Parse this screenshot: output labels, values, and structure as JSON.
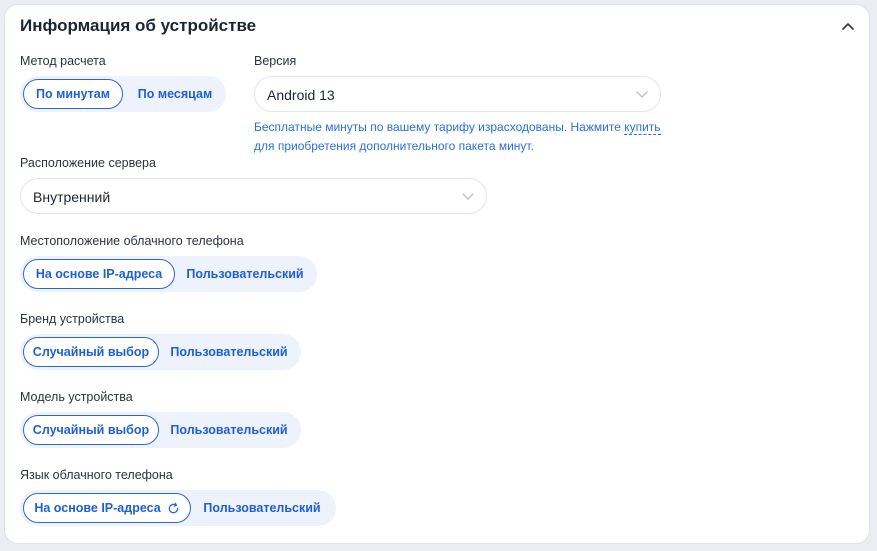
{
  "section": {
    "title": "Информация об устройстве"
  },
  "billing": {
    "label": "Метод расчета",
    "options": [
      "По минутам",
      "По месяцам"
    ],
    "selected": "По минутам"
  },
  "version": {
    "label": "Версия",
    "value": "Android 13"
  },
  "notice": {
    "text_before": "Бесплатные минуты по вашему тарифу израсходованы. Нажмите",
    "link": "купить",
    "text_after": "для приобретения дополнительного пакета минут."
  },
  "server_location": {
    "label": "Расположение сервера",
    "value": "Внутренний"
  },
  "phone_location": {
    "label": "Местоположение облачного телефона",
    "options": [
      "На основе IP-адреса",
      "Пользовательский"
    ],
    "selected": "На основе IP-адреса"
  },
  "brand": {
    "label": "Бренд устройства",
    "options": [
      "Случайный выбор",
      "Пользовательский"
    ],
    "selected": "Случайный выбор"
  },
  "model": {
    "label": "Модель устройства",
    "options": [
      "Случайный выбор",
      "Пользовательский"
    ],
    "selected": "Случайный выбор"
  },
  "language": {
    "label": "Язык облачного телефона",
    "options": [
      "На основе IP-адреса",
      "Пользовательский"
    ],
    "selected": "На основе IP-адреса"
  },
  "icons": {
    "collapse": "chevron-up-icon",
    "dropdown": "chevron-down-icon",
    "refresh": "refresh-icon"
  },
  "colors": {
    "accent": "#2b66d9",
    "segment_bg": "#edf2fc",
    "link": "#2a6fdb"
  }
}
